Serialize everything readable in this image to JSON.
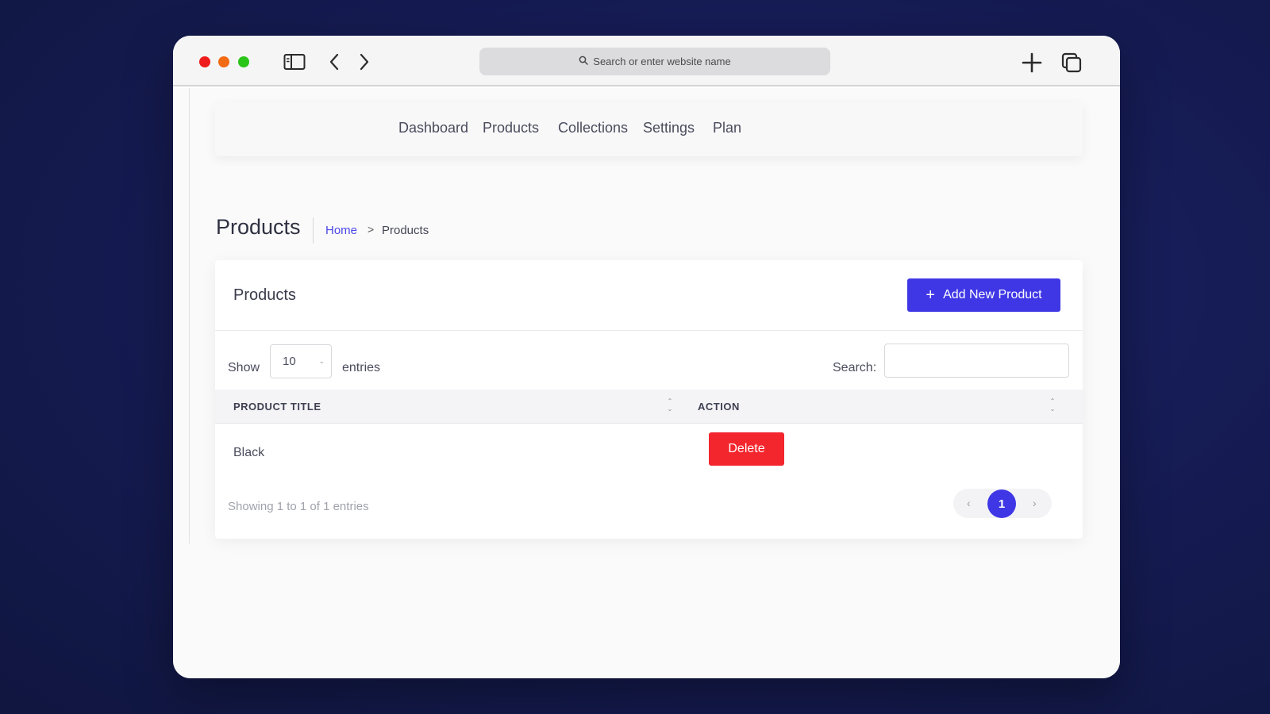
{
  "browser": {
    "address_placeholder": "Search or enter website name",
    "icons": [
      "sidebar-toggle-icon",
      "chevron-left-icon",
      "chevron-right-icon",
      "plus-icon",
      "tabs-overview-icon",
      "search-icon"
    ]
  },
  "nav": {
    "items": [
      "Dashboard",
      "Products",
      "Collections",
      "Settings",
      "Plan"
    ]
  },
  "page": {
    "title": "Products",
    "breadcrumb": {
      "home": "Home",
      "current": "Products",
      "separator": ">"
    }
  },
  "card": {
    "title": "Products",
    "add_button_label": "Add New Product",
    "show_label": "Show",
    "page_size": "10",
    "entries_label": "entries",
    "search_label": "Search:",
    "search_value": "",
    "columns": [
      "PRODUCT TITLE",
      "ACTION"
    ],
    "rows": [
      {
        "title": "Black",
        "action": "Delete"
      }
    ],
    "info": "Showing 1 to 1 of 1 entries",
    "pagination": {
      "prev": "‹",
      "current": "1",
      "next": "›"
    }
  },
  "colors": {
    "accent": "#3f37e5",
    "danger": "#f3262e",
    "background": "#161c55",
    "traffic_red": "#ee1c1c",
    "traffic_orange": "#f26a12",
    "traffic_green": "#2bc418"
  }
}
